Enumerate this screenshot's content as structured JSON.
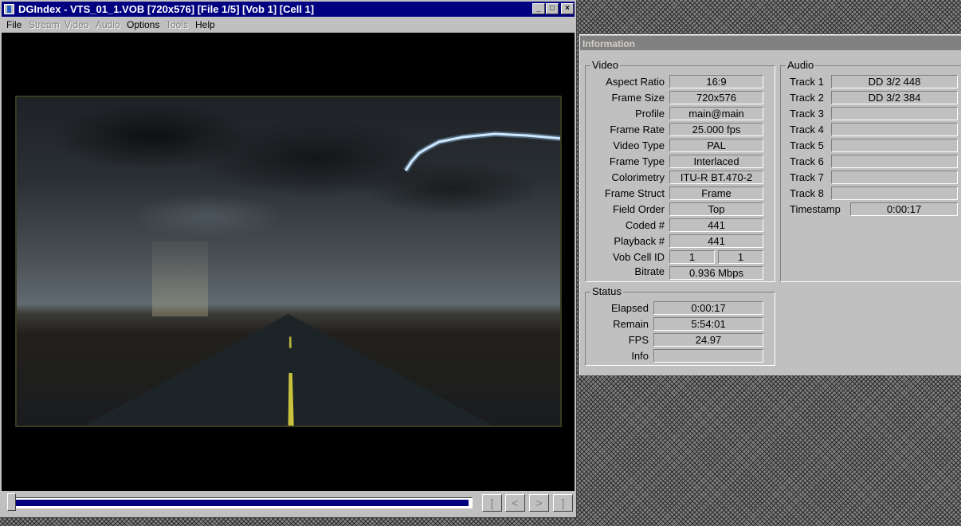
{
  "main_window": {
    "title": "DGIndex - VTS_01_1.VOB [720x576] [File 1/5] [Vob 1] [Cell 1]",
    "menu": [
      {
        "label": "File",
        "enabled": true
      },
      {
        "label": "Stream",
        "enabled": false
      },
      {
        "label": "Video",
        "enabled": false
      },
      {
        "label": "Audio",
        "enabled": false
      },
      {
        "label": "Options",
        "enabled": true
      },
      {
        "label": "Tools",
        "enabled": false
      },
      {
        "label": "Help",
        "enabled": true
      }
    ],
    "title_buttons": {
      "minimize": "_",
      "maximize": "□",
      "close": "×"
    },
    "progress_fraction": 0.995,
    "nav_buttons": [
      "[",
      "<",
      ">",
      "]"
    ]
  },
  "info": {
    "title": "Information",
    "video": {
      "group_label": "Video",
      "rows": [
        {
          "label": "Aspect Ratio",
          "value": "16:9"
        },
        {
          "label": "Frame Size",
          "value": "720x576"
        },
        {
          "label": "Profile",
          "value": "main@main"
        },
        {
          "label": "Frame Rate",
          "value": "25.000 fps"
        },
        {
          "label": "Video Type",
          "value": "PAL"
        },
        {
          "label": "Frame Type",
          "value": "Interlaced"
        },
        {
          "label": "Colorimetry",
          "value": "ITU-R BT.470-2"
        },
        {
          "label": "Frame Struct",
          "value": "Frame"
        },
        {
          "label": "Field Order",
          "value": "Top"
        },
        {
          "label": "Coded #",
          "value": "441"
        },
        {
          "label": "Playback #",
          "value": "441"
        }
      ],
      "vob_cell_label": "Vob Cell ID",
      "vob_id": "1",
      "cell_id": "1",
      "bitrate_label": "Bitrate",
      "bitrate": "0.936 Mbps"
    },
    "audio": {
      "group_label": "Audio",
      "tracks": [
        {
          "label": "Track 1",
          "value": "DD 3/2 448"
        },
        {
          "label": "Track 2",
          "value": "DD 3/2 384"
        },
        {
          "label": "Track 3",
          "value": ""
        },
        {
          "label": "Track 4",
          "value": ""
        },
        {
          "label": "Track 5",
          "value": ""
        },
        {
          "label": "Track 6",
          "value": ""
        },
        {
          "label": "Track 7",
          "value": ""
        },
        {
          "label": "Track 8",
          "value": ""
        }
      ],
      "timestamp_label": "Timestamp",
      "timestamp": "0:00:17"
    },
    "status": {
      "group_label": "Status",
      "rows": [
        {
          "label": "Elapsed",
          "value": "0:00:17"
        },
        {
          "label": "Remain",
          "value": "5:54:01"
        },
        {
          "label": "FPS",
          "value": "24.97"
        },
        {
          "label": "Info",
          "value": ""
        }
      ]
    }
  }
}
